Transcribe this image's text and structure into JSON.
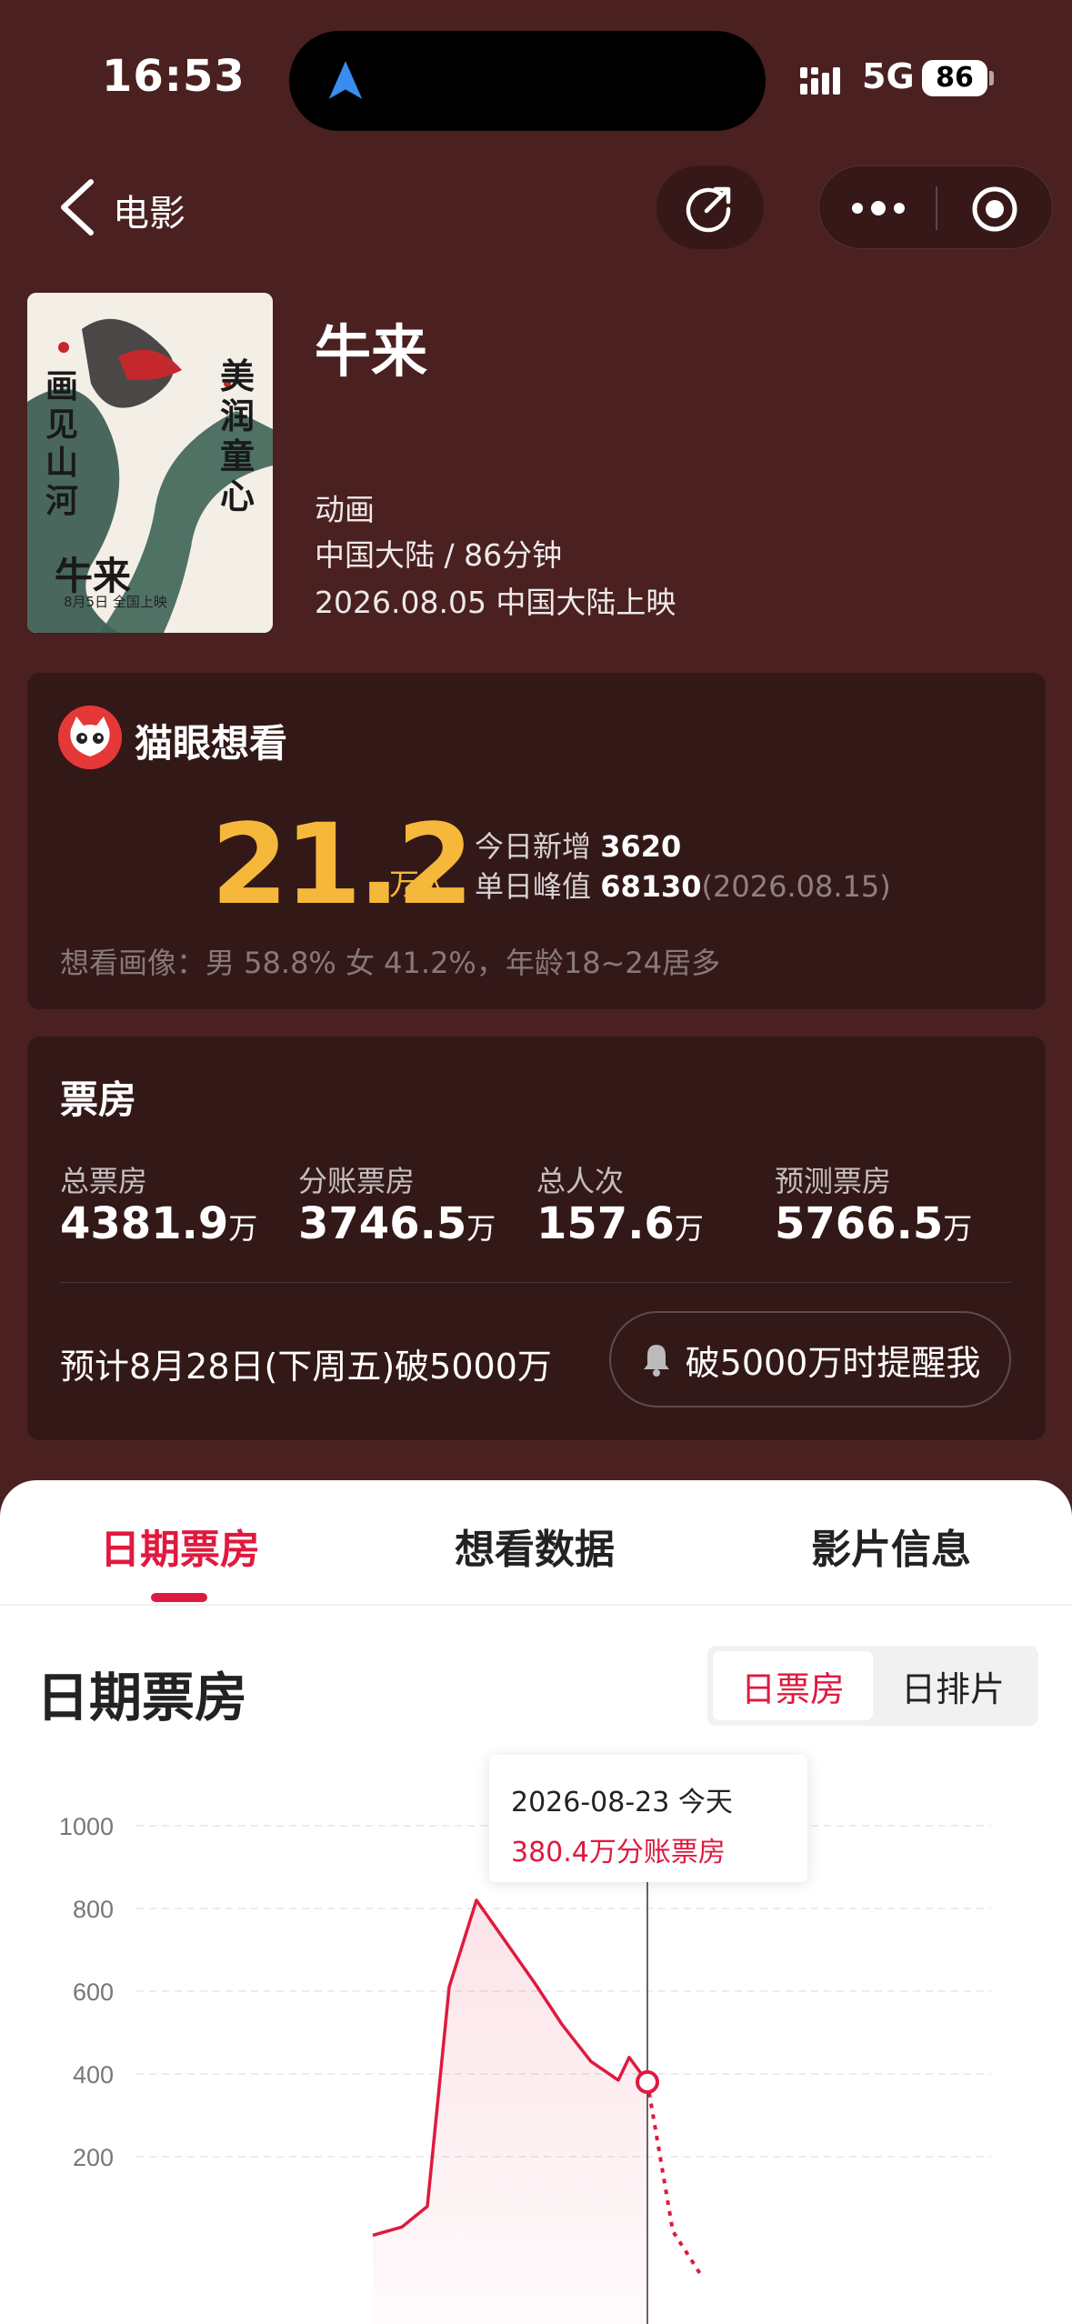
{
  "status_bar": {
    "time": "16:53",
    "network": "5G",
    "battery": "86"
  },
  "nav": {
    "back_label": "电影"
  },
  "movie": {
    "title": "牛来",
    "genre": "动画",
    "region_duration": "中国大陆 / 86分钟",
    "release": "2026.08.05 中国大陆上映",
    "poster_text": {
      "a": "美润童心",
      "b": "画见山河",
      "c": "牛来",
      "d": "8月5日 全国上映"
    }
  },
  "want": {
    "label": "猫眼想看",
    "number": "21.2",
    "unit": "万人",
    "today_label": "今日新增",
    "today_value": "3620",
    "peak_label": "单日峰值",
    "peak_value": "68130",
    "peak_date": "(2026.08.15)",
    "portrait": "想看画像：男 58.8% 女 41.2%，年龄18~24居多"
  },
  "box_office": {
    "title": "票房",
    "stats": [
      {
        "label": "总票房",
        "value": "4381.9",
        "unit": "万"
      },
      {
        "label": "分账票房",
        "value": "3746.5",
        "unit": "万"
      },
      {
        "label": "总人次",
        "value": "157.6",
        "unit": "万"
      },
      {
        "label": "预测票房",
        "value": "5766.5",
        "unit": "万"
      }
    ],
    "forecast": "预计8月28日(下周五)破5000万",
    "remind_label": "破5000万时提醒我"
  },
  "tabs": [
    "日期票房",
    "想看数据",
    "影片信息"
  ],
  "section": {
    "title": "日期票房",
    "toggle": [
      "日票房",
      "日排片"
    ]
  },
  "tooltip": {
    "date": "2026-08-23 今天",
    "value": "380.4万分账票房"
  },
  "colors": {
    "accent": "#e0193f",
    "gold": "#f5b83a",
    "background": "#4a2020"
  },
  "chart_data": {
    "type": "line",
    "yticks": [
      "1000",
      "800",
      "600",
      "400",
      "200"
    ],
    "ylim": [
      0,
      1000
    ],
    "series": [
      {
        "values": [
          10,
          30,
          80,
          610,
          820,
          720,
          620,
          520,
          430,
          385,
          440,
          380.4
        ],
        "style": "solid"
      },
      {
        "values": [
          380.4,
          20,
          5
        ],
        "style": "dotted"
      }
    ],
    "highlight_index": 11
  }
}
